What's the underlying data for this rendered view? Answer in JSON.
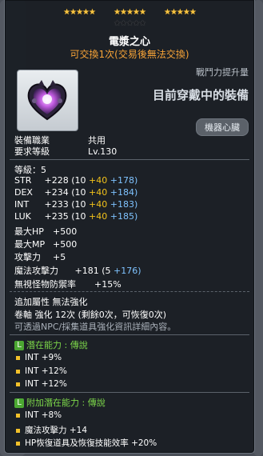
{
  "colors": {
    "star": "#f6c443",
    "legendary": "#4ca832",
    "bonus": "#f3c21a",
    "starforce_bonus": "#7fc3ff",
    "warning": "#f7a337"
  },
  "stars": {
    "filled": [
      "★★★★★",
      "★★★★★",
      "★★★★★"
    ],
    "empty": "★★★★★"
  },
  "item": {
    "name": "電漿之心",
    "trade_note": "可交換1次(交易後無法交換)",
    "icon": "plasma-heart-icon",
    "power_label": "戰鬥力提升量",
    "equipped_text": "目前穿戴中的裝備",
    "category_badge": "機器心臟"
  },
  "req": {
    "job_label": "裝備職業",
    "job_value": "共用",
    "level_label": "要求等級",
    "level_value": "Lv.130"
  },
  "level": {
    "label": "等級：",
    "value": "5"
  },
  "stats": [
    {
      "name": "STR",
      "total": "+228",
      "base": "(10",
      "bonus": "+40",
      "sf": "+178)"
    },
    {
      "name": "DEX",
      "total": "+234",
      "base": "(10",
      "bonus": "+40",
      "sf": "+184)"
    },
    {
      "name": "INT",
      "total": "+233",
      "base": "(10",
      "bonus": "+40",
      "sf": "+183)"
    },
    {
      "name": "LUK",
      "total": "+235",
      "base": "(10",
      "bonus": "+40",
      "sf": "+185)"
    }
  ],
  "misc": [
    {
      "name": "最大HP",
      "value": "+500"
    },
    {
      "name": "最大MP",
      "value": "+500"
    },
    {
      "name": "攻擊力",
      "value": "+5"
    }
  ],
  "magic_attack": {
    "name": "魔法攻擊力",
    "total": "+181",
    "base": "(5",
    "sf": "+176)"
  },
  "ignore_def": {
    "name": "無視怪物防禦率",
    "value": "+15%"
  },
  "extra": {
    "attr_line": "追加屬性 無法強化",
    "scroll_line": "卷軸 強化 12次 (剩餘0次，可恢復0次)",
    "hint": "可透過NPC/採集道具強化資訊詳細內容。"
  },
  "potential": {
    "badge": "L",
    "title": "潛在能力 : 傳說",
    "lines": [
      "INT +9%",
      "INT +12%",
      "INT +12%"
    ]
  },
  "bonus_potential": {
    "badge": "L",
    "title": "附加潛在能力 : 傳說",
    "lines": [
      "INT +8%",
      "魔法攻擊力 +14",
      "HP恢復道具及恢復技能效率 +20%"
    ]
  }
}
